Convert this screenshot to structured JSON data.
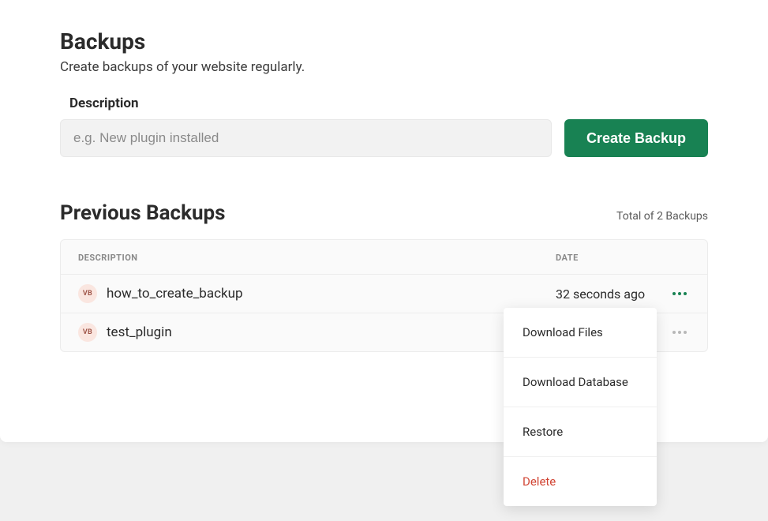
{
  "page": {
    "title": "Backups",
    "subtitle": "Create backups of your website regularly."
  },
  "form": {
    "label": "Description",
    "placeholder": "e.g. New plugin installed",
    "create_button": "Create Backup"
  },
  "previous": {
    "title": "Previous Backups",
    "total_text": "Total of 2 Backups",
    "columns": {
      "description": "DESCRIPTION",
      "date": "DATE"
    },
    "badge_text": "VB",
    "rows": [
      {
        "description": "how_to_create_backup",
        "date": "32 seconds ago"
      },
      {
        "description": "test_plugin",
        "date": ""
      }
    ]
  },
  "dropdown": {
    "download_files": "Download Files",
    "download_database": "Download Database",
    "restore": "Restore",
    "delete": "Delete"
  }
}
